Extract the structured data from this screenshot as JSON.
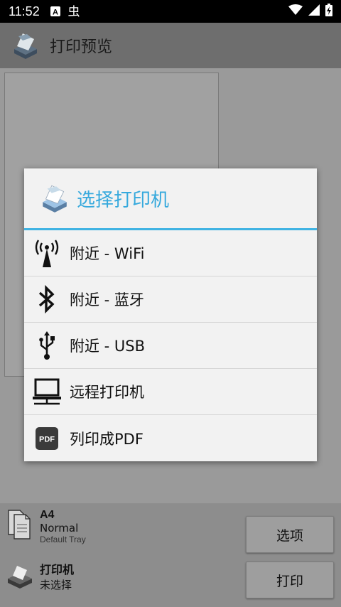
{
  "status_bar": {
    "time": "11:52",
    "icons": [
      "a-notification-icon",
      "bug-notification-icon",
      "wifi-icon",
      "signal-icon",
      "battery-charging-icon"
    ]
  },
  "app_bar": {
    "title": "打印预览",
    "icon": "printer-app-icon"
  },
  "dialog": {
    "title": "选择打印机",
    "accent_color": "#36a9dd",
    "items": [
      {
        "label": "附近 - WiFi",
        "icon": "wifi-antenna-icon"
      },
      {
        "label": "附近 - 蓝牙",
        "icon": "bluetooth-icon"
      },
      {
        "label": "附近 - USB",
        "icon": "usb-icon"
      },
      {
        "label": "远程打印机",
        "icon": "computer-network-icon"
      },
      {
        "label": "列印成PDF",
        "icon": "pdf-icon"
      }
    ]
  },
  "bottom": {
    "paper_size": "A4",
    "paper_quality": "Normal",
    "paper_tray": "Default Tray",
    "printer_label": "打印机",
    "printer_value": "未选择",
    "options_button": "选项",
    "print_button": "打印"
  }
}
